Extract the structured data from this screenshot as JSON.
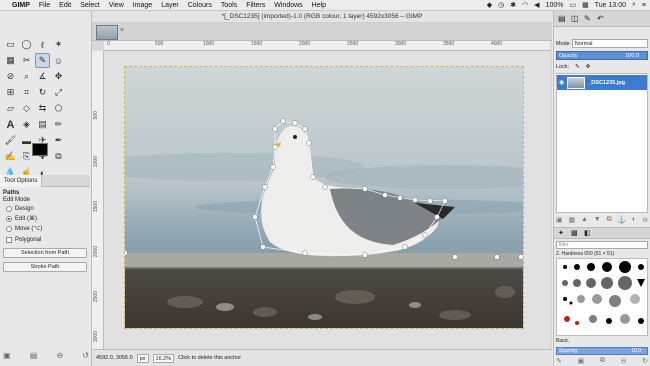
{
  "menubar": {
    "app": "GIMP",
    "items": [
      "File",
      "Edit",
      "Select",
      "View",
      "Image",
      "Layer",
      "Colours",
      "Tools",
      "Filters",
      "Windows",
      "Help"
    ],
    "battery": "100%",
    "clock": "Tue 13:00"
  },
  "window": {
    "title": "*[_DSC1235] (imported)-1.0 (RGB colour, 1 layer) 4592x3056 – GIMP"
  },
  "ruler": {
    "h_ticks": [
      "0",
      "500",
      "1000",
      "1500",
      "2000",
      "2500",
      "3000",
      "3500",
      "4000"
    ],
    "v_ticks": [
      "500",
      "1000",
      "1500",
      "2000",
      "2500",
      "3000"
    ]
  },
  "tool_options": {
    "tab_label": "Tool Options",
    "heading": "Paths",
    "edit_mode_label": "Edit Mode",
    "modes": [
      {
        "label": "Design",
        "selected": false
      },
      {
        "label": "Edit (⌘)",
        "selected": true
      },
      {
        "label": "Move (⌥)",
        "selected": false
      }
    ],
    "polygonal_label": "Polygonal",
    "selection_button": "Selection from Path",
    "stroke_button": "Stroke Path"
  },
  "statusbar": {
    "coords": "4592.0, 3056.0",
    "unit": "px",
    "zoom": "16.2%",
    "message": "Click to delete this anchor"
  },
  "layers": {
    "mode_label": "Mode",
    "mode_value": "Normal",
    "opacity_label": "Opacity",
    "opacity_value": "100.0",
    "lock_label": "Lock:",
    "layer_name": "_DSC1235.jpg"
  },
  "brushes": {
    "filter_placeholder": "filter",
    "title": "2. Hardness 050 (51 × 51)",
    "preset_label": "Basic,",
    "spacing_label": "Spacing",
    "spacing_value": "10.0"
  },
  "colors": {
    "accent": "#3d7bd0",
    "selection_dash": "#c8b85c",
    "fg": "#000000",
    "bg": "#ffffff"
  }
}
